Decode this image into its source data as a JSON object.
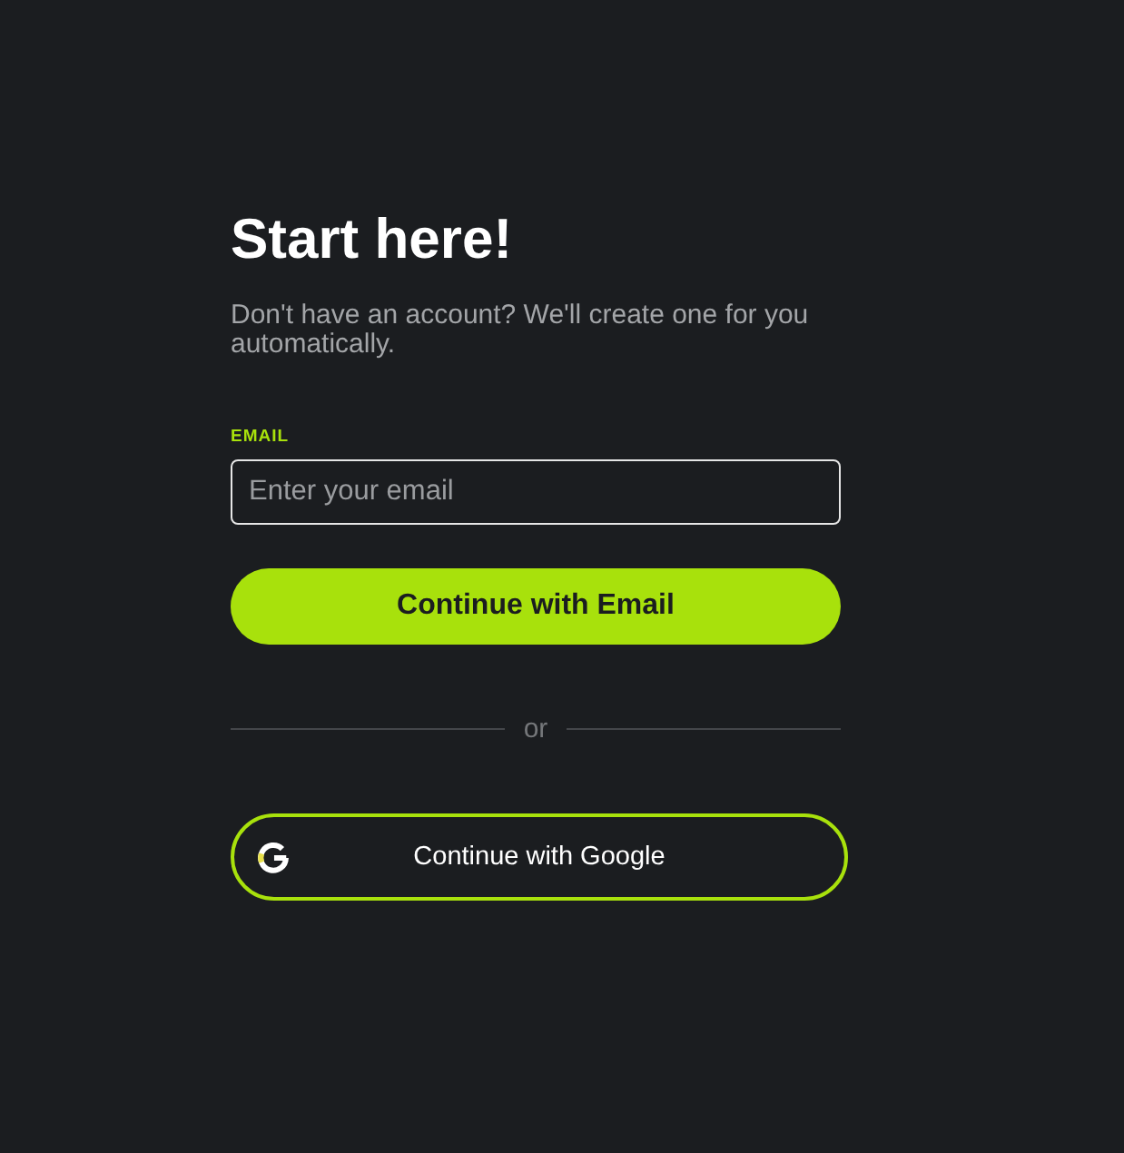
{
  "title": "Start here!",
  "subtitle": "Don't have an account? We'll create one for you automatically.",
  "email": {
    "label": "EMAIL",
    "placeholder": "Enter your email"
  },
  "primary_button": "Continue with Email",
  "divider": "or",
  "google_button": "Continue with Google"
}
